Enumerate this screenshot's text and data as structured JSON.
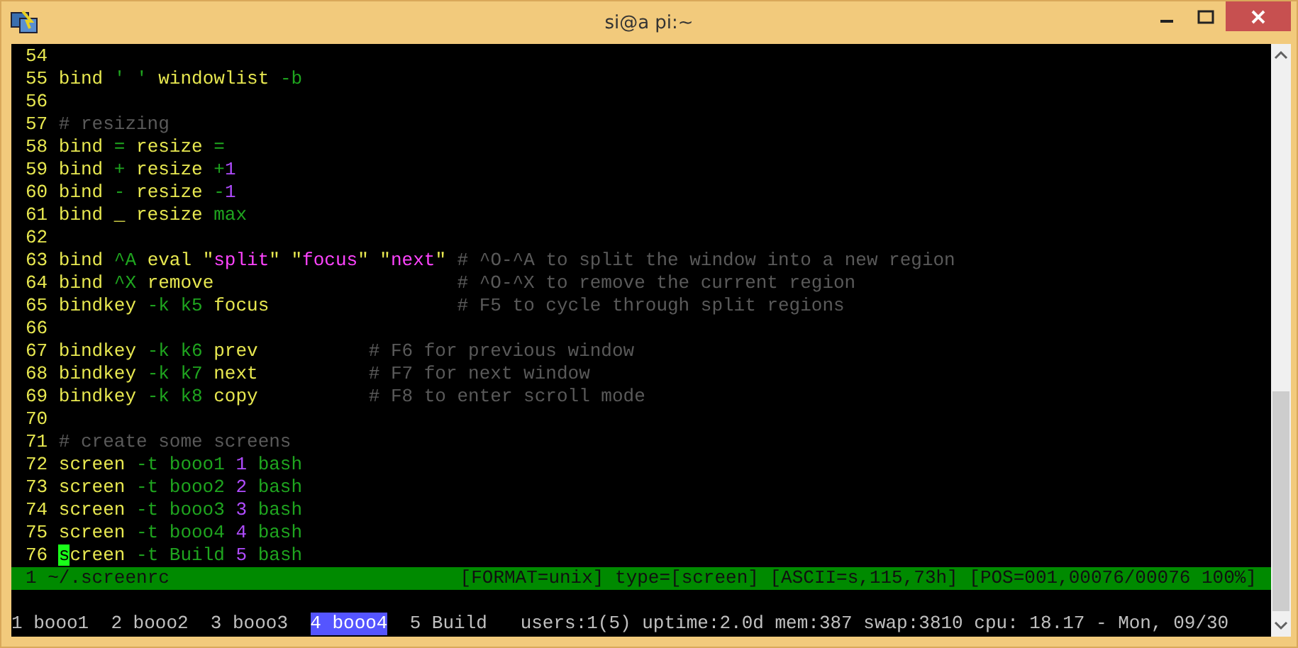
{
  "window": {
    "title": "si@a pi:~"
  },
  "editor": {
    "lines": [
      {
        "number": "54"
      },
      {
        "number": "55",
        "segments": [
          {
            "text": "bind ",
            "kind": "keyword"
          },
          {
            "text": "' '",
            "kind": "option"
          },
          {
            "text": " windowlist",
            "kind": "keyword"
          },
          {
            "text": " -b",
            "kind": "option"
          }
        ]
      },
      {
        "number": "56"
      },
      {
        "number": "57",
        "segments": [
          {
            "text": "# resizing",
            "kind": "comment"
          }
        ]
      },
      {
        "number": "58",
        "segments": [
          {
            "text": "bind ",
            "kind": "keyword"
          },
          {
            "text": "= ",
            "kind": "option"
          },
          {
            "text": "resize ",
            "kind": "keyword"
          },
          {
            "text": "=",
            "kind": "option"
          }
        ]
      },
      {
        "number": "59",
        "segments": [
          {
            "text": "bind ",
            "kind": "keyword"
          },
          {
            "text": "+ ",
            "kind": "option"
          },
          {
            "text": "resize ",
            "kind": "keyword"
          },
          {
            "text": "+",
            "kind": "option"
          },
          {
            "text": "1",
            "kind": "number"
          }
        ]
      },
      {
        "number": "60",
        "segments": [
          {
            "text": "bind ",
            "kind": "keyword"
          },
          {
            "text": "- ",
            "kind": "option"
          },
          {
            "text": "resize ",
            "kind": "keyword"
          },
          {
            "text": "-",
            "kind": "option"
          },
          {
            "text": "1",
            "kind": "number"
          }
        ]
      },
      {
        "number": "61",
        "segments": [
          {
            "text": "bind _ resize ",
            "kind": "keyword"
          },
          {
            "text": "max",
            "kind": "option"
          }
        ]
      },
      {
        "number": "62"
      },
      {
        "number": "63",
        "segments": [
          {
            "text": "bind ",
            "kind": "keyword"
          },
          {
            "text": "^A ",
            "kind": "option"
          },
          {
            "text": "eval \"",
            "kind": "keyword"
          },
          {
            "text": "split",
            "kind": "string"
          },
          {
            "text": "\" \"",
            "kind": "keyword"
          },
          {
            "text": "focus",
            "kind": "string"
          },
          {
            "text": "\" \"",
            "kind": "keyword"
          },
          {
            "text": "next",
            "kind": "string"
          },
          {
            "text": "\" ",
            "kind": "keyword"
          },
          {
            "text": "# ^O-^A to split the window into a new region",
            "kind": "comment"
          }
        ]
      },
      {
        "number": "64",
        "segments": [
          {
            "text": "bind ",
            "kind": "keyword"
          },
          {
            "text": "^X ",
            "kind": "option"
          },
          {
            "text": "remove                      ",
            "kind": "keyword"
          },
          {
            "text": "# ^O-^X to remove the current region",
            "kind": "comment"
          }
        ]
      },
      {
        "number": "65",
        "segments": [
          {
            "text": "bindkey ",
            "kind": "keyword"
          },
          {
            "text": "-k k5 ",
            "kind": "option"
          },
          {
            "text": "focus                 ",
            "kind": "keyword"
          },
          {
            "text": "# F5 to cycle through split regions",
            "kind": "comment"
          }
        ]
      },
      {
        "number": "66"
      },
      {
        "number": "67",
        "segments": [
          {
            "text": "bindkey ",
            "kind": "keyword"
          },
          {
            "text": "-k k6 ",
            "kind": "option"
          },
          {
            "text": "prev          ",
            "kind": "keyword"
          },
          {
            "text": "# F6 for previous window",
            "kind": "comment"
          }
        ]
      },
      {
        "number": "68",
        "segments": [
          {
            "text": "bindkey ",
            "kind": "keyword"
          },
          {
            "text": "-k k7 ",
            "kind": "option"
          },
          {
            "text": "next          ",
            "kind": "keyword"
          },
          {
            "text": "# F7 for next window",
            "kind": "comment"
          }
        ]
      },
      {
        "number": "69",
        "segments": [
          {
            "text": "bindkey ",
            "kind": "keyword"
          },
          {
            "text": "-k k8 ",
            "kind": "option"
          },
          {
            "text": "copy          ",
            "kind": "keyword"
          },
          {
            "text": "# F8 to enter scroll mode",
            "kind": "comment"
          }
        ]
      },
      {
        "number": "70"
      },
      {
        "number": "71",
        "segments": [
          {
            "text": "# create some screens",
            "kind": "comment"
          }
        ]
      },
      {
        "number": "72",
        "segments": [
          {
            "text": "screen ",
            "kind": "keyword"
          },
          {
            "text": "-t booo1 ",
            "kind": "option"
          },
          {
            "text": "1",
            "kind": "number"
          },
          {
            "text": " bash",
            "kind": "option"
          }
        ]
      },
      {
        "number": "73",
        "segments": [
          {
            "text": "screen ",
            "kind": "keyword"
          },
          {
            "text": "-t booo2 ",
            "kind": "option"
          },
          {
            "text": "2",
            "kind": "number"
          },
          {
            "text": " bash",
            "kind": "option"
          }
        ]
      },
      {
        "number": "74",
        "segments": [
          {
            "text": "screen ",
            "kind": "keyword"
          },
          {
            "text": "-t booo3 ",
            "kind": "option"
          },
          {
            "text": "3",
            "kind": "number"
          },
          {
            "text": " bash",
            "kind": "option"
          }
        ]
      },
      {
        "number": "75",
        "segments": [
          {
            "text": "screen ",
            "kind": "keyword"
          },
          {
            "text": "-t booo4 ",
            "kind": "option"
          },
          {
            "text": "4",
            "kind": "number"
          },
          {
            "text": " bash",
            "kind": "option"
          }
        ]
      },
      {
        "number": "76",
        "segments": [
          {
            "text": "s",
            "kind": "cursor"
          },
          {
            "text": "creen ",
            "kind": "keyword"
          },
          {
            "text": "-t Build ",
            "kind": "option"
          },
          {
            "text": "5",
            "kind": "number"
          },
          {
            "text": " bash",
            "kind": "option"
          }
        ]
      }
    ]
  },
  "status_line": {
    "file": "1 ~/.screenrc",
    "info": "[FORMAT=unix] type=[screen] [ASCII=s,115,73h] [POS=001,00076/00076 100%]"
  },
  "window_bar": {
    "windows": [
      {
        "label": "1 booo1",
        "selected": false
      },
      {
        "label": "2 booo2",
        "selected": false
      },
      {
        "label": "3 booo3",
        "selected": false
      },
      {
        "label": "4 booo4",
        "selected": true
      },
      {
        "label": "5 Build",
        "selected": false
      }
    ],
    "stats": "users:1(5) uptime:2.0d mem:387 swap:3810 cpu: 18.17 - Mon, 09/30"
  }
}
